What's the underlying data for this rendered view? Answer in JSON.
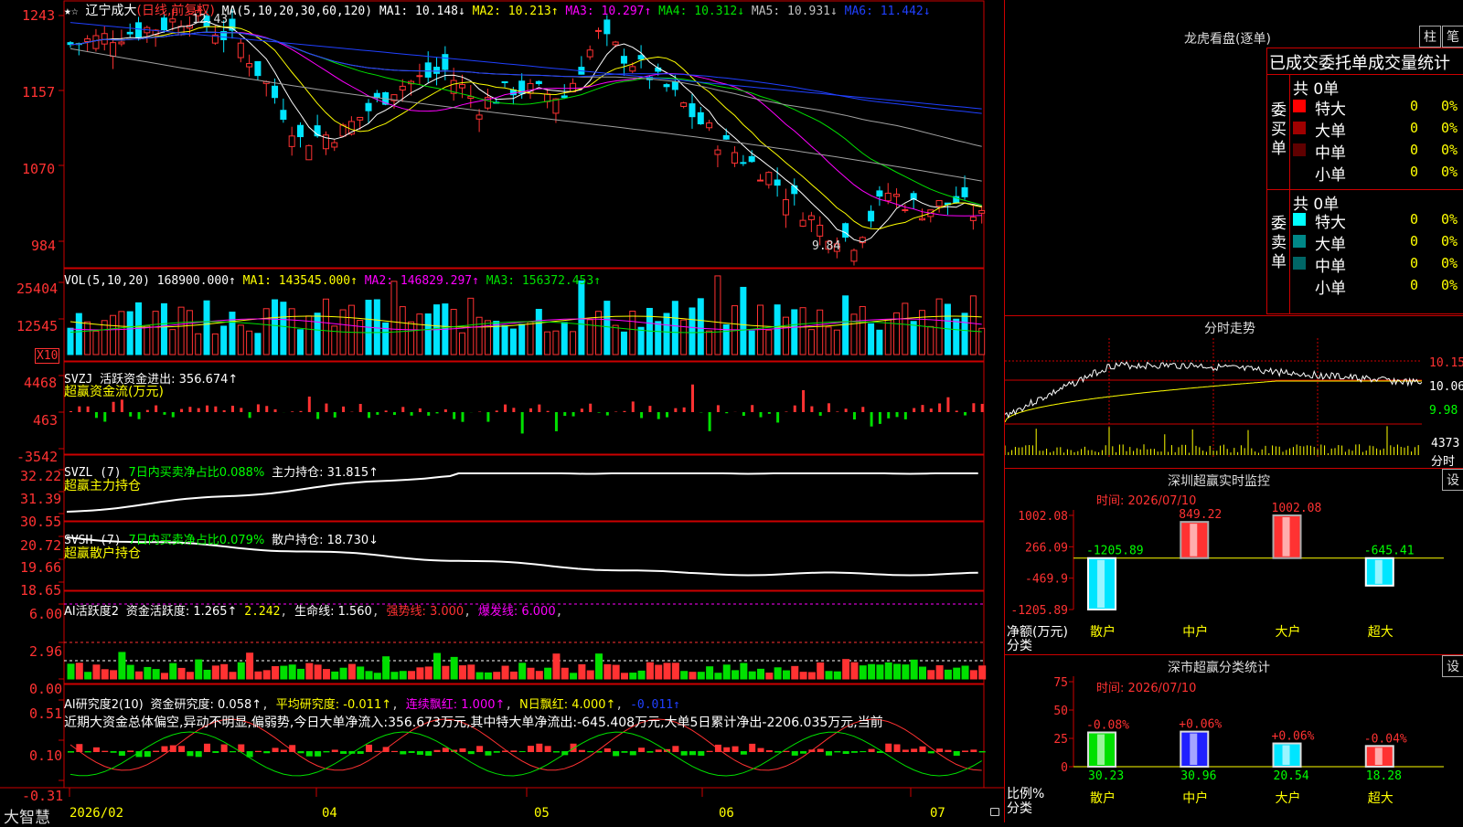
{
  "kline": {
    "stock_name": "辽宁成大",
    "period": "(日线,前复权)",
    "ma_params": "MA(5,10,20,30,60,120)",
    "ma1": "MA1: 10.148↓",
    "ma2": "MA2: 10.213↑",
    "ma3": "MA3: 10.297↑",
    "ma4": "MA4: 10.312↓",
    "ma5": "MA5: 10.931↓",
    "ma6": "MA6: 11.442↓",
    "y_ticks": [
      "1243",
      "1157",
      "1070",
      "984"
    ],
    "high_label": "12.43",
    "low_label": "9.84",
    "colors": {
      "up": "#ff3232",
      "down": "#00e5ff",
      "ma1": "#ffffff",
      "ma2": "#ffff00",
      "ma3": "#ff00ff",
      "ma4": "#00e000",
      "ma5": "#a0a0a0",
      "ma6": "#2040ff"
    }
  },
  "vol": {
    "params": "VOL(5,10,20)",
    "value": "168900.000↑",
    "ma1": "MA1: 143545.000↑",
    "ma2": "MA2: 146829.297↑",
    "ma3": "MA3: 156372.453↑",
    "y_ticks": [
      "25404",
      "12545"
    ],
    "unit": "X10"
  },
  "svzj": {
    "name": "SVZJ",
    "label": "活跃资金进出: 356.674↑",
    "sub": "超赢资金流(万元)",
    "y_ticks": [
      "4468",
      "463",
      "-3542"
    ]
  },
  "svzl": {
    "name": "SVZL (7)",
    "ratio": "7日内买卖净占比0.088%",
    "hold": "主力持仓: 31.815↑",
    "sub": "超赢主力持仓",
    "y_ticks": [
      "32.22",
      "31.39",
      "30.55"
    ]
  },
  "svsh": {
    "name": "SVSH (7)",
    "ratio": "7日内买卖净占比0.079%",
    "hold": "散户持仓: 18.730↓",
    "sub": "超赢散户持仓",
    "y_ticks": [
      "20.72",
      "19.66",
      "18.65"
    ]
  },
  "ai1": {
    "name": "AI活跃度2",
    "a": "资金活跃度: 1.265↑",
    "b": "2.242",
    "c": "生命线: 1.560",
    "d": "强势线: 3.000",
    "e": "爆发线: 6.000",
    "y_ticks": [
      "6.00",
      "2.96",
      "0.00"
    ]
  },
  "ai2": {
    "name": "AI研究度2(10)",
    "a": "资金研究度: 0.058↑",
    "b": "平均研究度: -0.011↑",
    "c": "连续飘红: 1.000↑",
    "d": "N日飘红: 4.000↑",
    "e": "-0.011↑",
    "comment": "近期大资金总体偏空,异动不明显,偏弱势,今日大单净流入:356.673万元,其中特大单净流出:-645.408万元,大单5日累计净出-2206.035万元,当前",
    "y_ticks": [
      "0.51",
      "0.10",
      "-0.31"
    ]
  },
  "xaxis": {
    "labels": [
      "2026/02",
      "04",
      "05",
      "06",
      "07"
    ],
    "brand": "大智慧"
  },
  "longhu": {
    "title": "龙虎看盘(逐单)",
    "btn_zhu": "柱",
    "btn_bi": "笔",
    "header": "已成交委托单成交量统计",
    "buy_label": "委买单",
    "sell_label": "委卖单",
    "buy_total": "共 0单",
    "sell_total": "共 0单",
    "buy_rows": [
      {
        "name": "特大",
        "qty": "0",
        "pct": "0%",
        "color": "#ff0000"
      },
      {
        "name": "大单",
        "qty": "0",
        "pct": "0%",
        "color": "#a00000"
      },
      {
        "name": "中单",
        "qty": "0",
        "pct": "0%",
        "color": "#600000"
      },
      {
        "name": "小单",
        "qty": "0",
        "pct": "0%",
        "color": "#000000"
      }
    ],
    "sell_rows": [
      {
        "name": "特大",
        "qty": "0",
        "pct": "0%",
        "color": "#00ffff"
      },
      {
        "name": "大单",
        "qty": "0",
        "pct": "0%",
        "color": "#008888"
      },
      {
        "name": "中单",
        "qty": "0",
        "pct": "0%",
        "color": "#006666"
      },
      {
        "name": "小单",
        "qty": "0",
        "pct": "0%",
        "color": "#000000"
      }
    ]
  },
  "intraday": {
    "title": "分时走势",
    "y_ticks": [
      "10.15",
      "10.06",
      "9.98"
    ],
    "vol_tick": "4373",
    "vol_unit": "分时"
  },
  "monitor": {
    "title": "深圳超赢实时监控",
    "btn": "设",
    "time": "时间: 2026/07/10",
    "y_ticks": [
      "1002.08",
      "266.09",
      "-469.9",
      "-1205.89"
    ],
    "ylabel": "净额(万元)",
    "xlabel": "分类",
    "categories": [
      "散户",
      "中户",
      "大户",
      "超大"
    ],
    "values": [
      -1205.89,
      849.22,
      1002.08,
      -645.41
    ],
    "value_labels": [
      "-1205.89",
      "849.22",
      "1002.08",
      "-645.41"
    ]
  },
  "classify": {
    "title": "深市超赢分类统计",
    "btn": "设",
    "time": "时间: 2026/07/10",
    "y_ticks": [
      "75",
      "50",
      "25",
      "0"
    ],
    "ylabel": "比例%",
    "xlabel": "分类",
    "categories": [
      "散户",
      "中户",
      "大户",
      "超大"
    ],
    "values": [
      30.23,
      30.96,
      20.54,
      18.28
    ],
    "value_labels": [
      "30.23",
      "30.96",
      "20.54",
      "18.28"
    ],
    "changes": [
      "-0.08%",
      "+0.06%",
      "+0.06%",
      "-0.04%"
    ]
  },
  "chart_data": [
    {
      "type": "bar",
      "title": "深圳超赢实时监控",
      "ylabel": "净额(万元)",
      "xlabel": "分类",
      "categories": [
        "散户",
        "中户",
        "大户",
        "超大"
      ],
      "values": [
        -1205.89,
        849.22,
        1002.08,
        -645.41
      ],
      "ylim": [
        -1205.89,
        1002.08
      ]
    },
    {
      "type": "bar",
      "title": "深市超赢分类统计",
      "ylabel": "比例%",
      "xlabel": "分类",
      "categories": [
        "散户",
        "中户",
        "大户",
        "超大"
      ],
      "values": [
        30.23,
        30.96,
        20.54,
        18.28
      ],
      "ylim": [
        0,
        75
      ]
    }
  ]
}
